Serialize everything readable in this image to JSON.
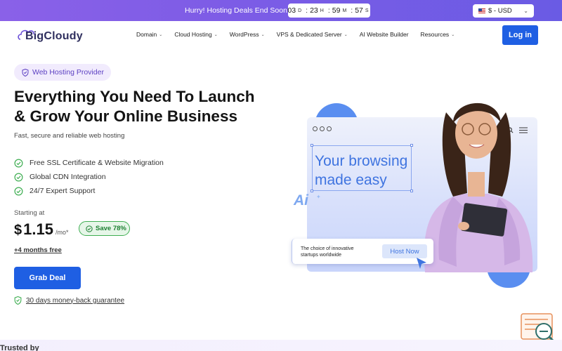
{
  "promo": {
    "text": "Hurry! Hosting Deals End Soon :",
    "timer": {
      "days": "03",
      "d": "D",
      "hours": "23",
      "h": "H",
      "minutes": "59",
      "m": "M",
      "seconds": "57",
      "s": "S"
    },
    "currency": "$ - USD"
  },
  "header": {
    "logo": "BigCloudy",
    "nav": [
      "Domain",
      "Cloud Hosting",
      "WordPress",
      "VPS & Dedicated Server",
      "AI Website Builder",
      "Resources"
    ],
    "login_label": "Log in"
  },
  "hero": {
    "pill": "Web Hosting Provider",
    "title_line1": "Everything You Need To Launch",
    "title_line2": "& Grow Your Online Business",
    "subtitle": "Fast, secure and reliable web hosting",
    "features": [
      "Free SSL Certificate & Website Migration",
      "Global CDN Integration",
      "24/7 Expert Support"
    ],
    "starting_at": "Starting at",
    "currency_symbol": "$",
    "price": "1.15",
    "per": "/mo*",
    "save": "Save 78%",
    "free_months": "+4 months free",
    "cta": "Grab Deal",
    "guarantee": "30 days money-back guarantee"
  },
  "illustration": {
    "headline": "Your browsing made easy",
    "ai_badge": "Ai",
    "card_text": "The choice of innovative startups worldwide",
    "host_now": "Host Now"
  },
  "trusted": "Trusted by",
  "colors": {
    "primary": "#1f5fe3",
    "promo": "#7d5ce6",
    "accent_green": "#3fae52"
  }
}
